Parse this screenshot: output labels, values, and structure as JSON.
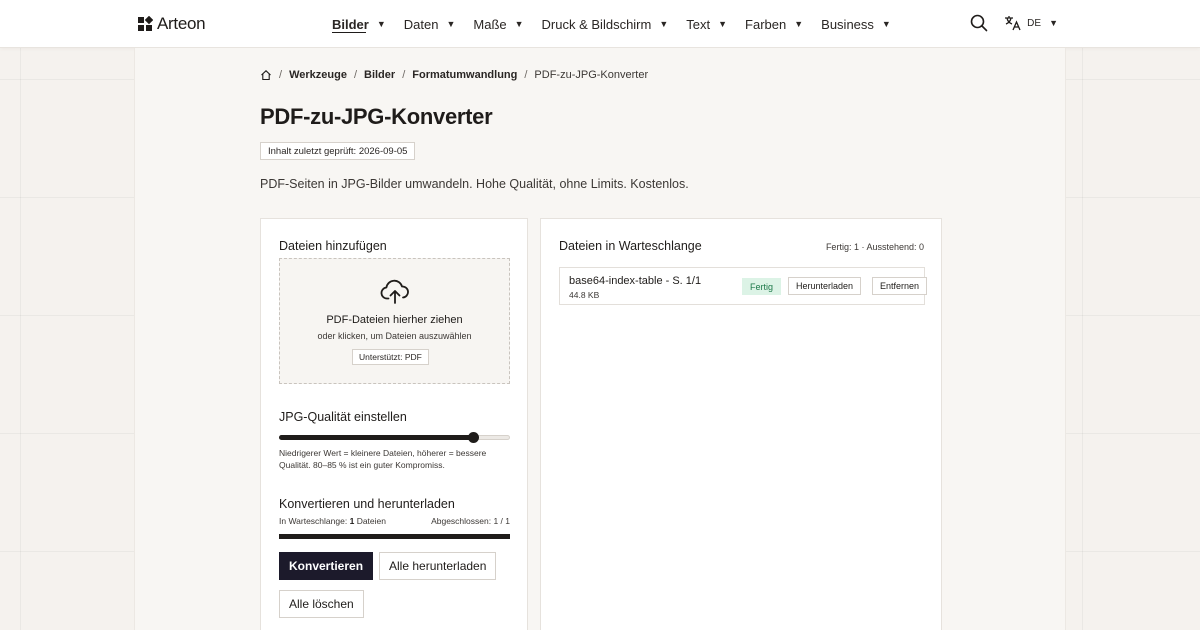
{
  "brand": {
    "name": "Arteon"
  },
  "nav": {
    "items": [
      {
        "label": "Bilder",
        "active": true
      },
      {
        "label": "Daten"
      },
      {
        "label": "Maße"
      },
      {
        "label": "Druck & Bildschirm"
      },
      {
        "label": "Text"
      },
      {
        "label": "Farben"
      },
      {
        "label": "Business"
      }
    ],
    "caret": "▼"
  },
  "header": {
    "language": "DE",
    "caret": "▼"
  },
  "breadcrumb": {
    "sep": "/",
    "items": [
      "Werkzeuge",
      "Bilder",
      "Formatumwandlung"
    ],
    "current": "PDF-zu-JPG-Konverter"
  },
  "page": {
    "title": "PDF-zu-JPG-Konverter",
    "reviewed": "Inhalt zuletzt geprüft: 2026-09-05",
    "subtitle": "PDF-Seiten in JPG-Bilder umwandeln. Hohe Qualität, ohne Limits. Kostenlos."
  },
  "upload": {
    "title": "Dateien hinzufügen",
    "dropzone_title": "PDF-Dateien hierher ziehen",
    "dropzone_sub": "oder klicken, um Dateien auszuwählen",
    "supported": "Unterstützt: PDF"
  },
  "quality": {
    "title": "JPG-Qualität einstellen",
    "value_fraction": 0.84,
    "hint": "Niedrigerer Wert = kleinere Dateien, höherer = bessere Qualität. 80–85 % ist ein guter Kompromiss."
  },
  "convert": {
    "title": "Konvertieren und herunterladen",
    "queued_prefix": "In Warteschlange:",
    "queued_count": "1",
    "queued_suffix": "Dateien",
    "done_label": "Abgeschlossen: 1 / 1",
    "progress_fraction": 1.0,
    "convert_button": "Konvertieren",
    "download_all_button": "Alle herunterladen",
    "clear_all_button": "Alle löschen"
  },
  "queue": {
    "title": "Dateien in Warteschlange",
    "status": "Fertig: 1 · Ausstehend: 0",
    "files": [
      {
        "name": "base64-index-table - S. 1/1",
        "size": "44.8 KB",
        "status": "Fertig",
        "download": "Herunterladen",
        "remove": "Entfernen"
      }
    ]
  },
  "colors": {
    "accent": "#1c1a2b",
    "success_bg": "#dcf3e6",
    "success_text": "#1f7a4b"
  }
}
